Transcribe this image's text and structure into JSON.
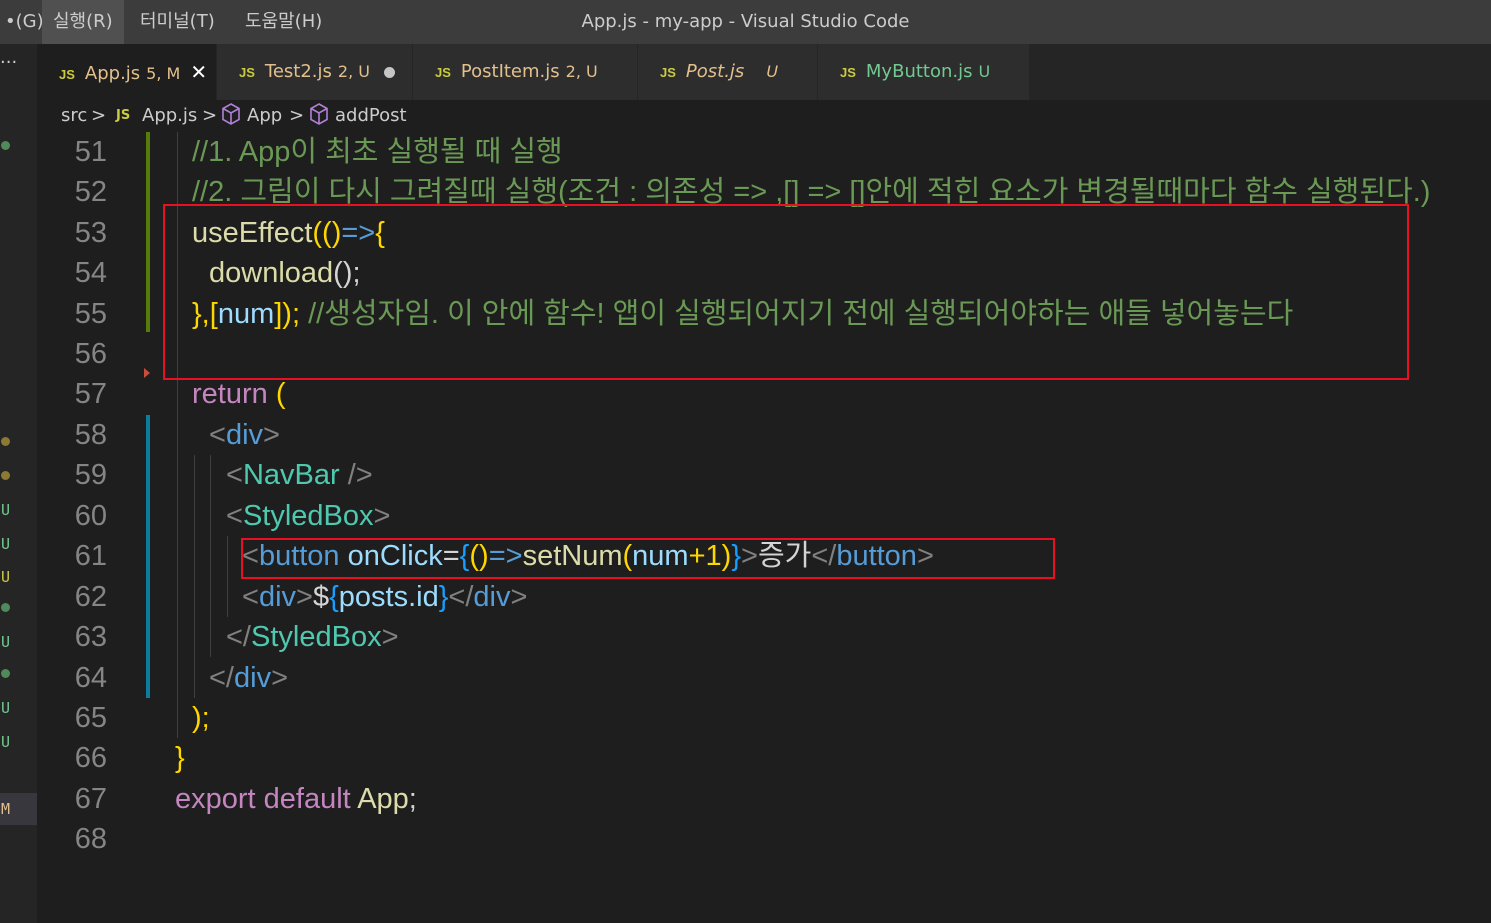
{
  "menu": {
    "items": [
      "•(G)",
      "실행(R)",
      "터미널(T)",
      "도움말(H)"
    ]
  },
  "window_title": "App.js - my-app - Visual Studio Code",
  "explorer": {
    "more_label": "···"
  },
  "git_markers": [
    {
      "kind": "dot",
      "color": "#4f8a5b"
    },
    {
      "kind": "dot",
      "color": "#8a7a33"
    },
    {
      "kind": "dot",
      "color": "#8a7a33"
    },
    {
      "kind": "letter",
      "text": "U",
      "color": "#73c991"
    },
    {
      "kind": "letter",
      "text": "U",
      "color": "#73c991"
    },
    {
      "kind": "letter",
      "text": "U",
      "color": "#cbcb41"
    },
    {
      "kind": "dot",
      "color": "#4f8a5b"
    },
    {
      "kind": "letter",
      "text": "U",
      "color": "#73c991"
    },
    {
      "kind": "dot",
      "color": "#4f8a5b"
    },
    {
      "kind": "letter",
      "text": "U",
      "color": "#73c991"
    },
    {
      "kind": "letter",
      "text": "U",
      "color": "#73c991"
    },
    {
      "kind": "letter",
      "text": "M",
      "color": "#e2c08d"
    }
  ],
  "tabs": [
    {
      "icon": "JS",
      "name": "App.js",
      "status": "5, M",
      "state": "modified",
      "active": true,
      "close": "✕"
    },
    {
      "icon": "JS",
      "name": "Test2.js",
      "status": "2, U",
      "state": "modified",
      "active": false,
      "dirty": true
    },
    {
      "icon": "JS",
      "name": "PostItem.js",
      "status": "2, U",
      "state": "modified",
      "active": false
    },
    {
      "icon": "JS",
      "name": "Post.js",
      "status": "U",
      "state": "italic",
      "active": false
    },
    {
      "icon": "JS",
      "name": "MyButton.js",
      "status": "U",
      "state": "untracked",
      "active": false
    }
  ],
  "breadcrumb": {
    "folder": "src",
    "file_icon": "JS",
    "file": "App.js",
    "symbol1": "App",
    "symbol2": "addPost",
    "separator": ">"
  },
  "code": {
    "line_numbers": [
      "51",
      "52",
      "53",
      "54",
      "55",
      "56",
      "57",
      "58",
      "59",
      "60",
      "61",
      "62",
      "63",
      "64",
      "65",
      "66",
      "67",
      "68"
    ],
    "l51": "//1. App이 최초 실행될 때 실행",
    "l52": "//2. 그림이 다시 그려질때 실행(조건 : 의존성 => ,[] => []안에 적힌 요소가 변경될때마다 함수 실행된다.)",
    "l53_fn": "useEffect",
    "l53_p1": "(()",
    "l53_arrow": "=>",
    "l53_brace": "{",
    "l54_fn": "download",
    "l54_p": "();",
    "l55_p1": "},[",
    "l55_var": "num",
    "l55_p2": "]);",
    "l55_comment": " //생성자임. 이 안에 함수! 앱이 실행되어지기 전에 실행되어야하는 애들 넣어놓는다",
    "l57_kw": "return",
    "l57_p": " (",
    "l58_lt": "<",
    "l58_tag": "div",
    "l58_gt": ">",
    "l59_lt": "<",
    "l59_comp": "NavBar",
    "l59_end": " />",
    "l60_lt": "<",
    "l60_comp": "StyledBox",
    "l60_gt": ">",
    "l61_lt": "<",
    "l61_tag": "button",
    "l61_attr": " onClick",
    "l61_eq": "=",
    "l61_ob": "{",
    "l61_paren": "()",
    "l61_arrow": "=>",
    "l61_fn": "setNum",
    "l61_op": "(",
    "l61_var": "num",
    "l61_plus": "+1)",
    "l61_cb": "}",
    "l61_gt": ">",
    "l61_text": "증가",
    "l61_close_lt": "</",
    "l61_close_tag": "button",
    "l61_close_gt": ">",
    "l62_lt": "<",
    "l62_tag": "div",
    "l62_gt": ">",
    "l62_dollar": "$",
    "l62_ob": "{",
    "l62_var": "posts.id",
    "l62_cb": "}",
    "l62_close_lt": "</",
    "l62_close_tag": "div",
    "l62_close_gt": ">",
    "l63_lt": "</",
    "l63_comp": "StyledBox",
    "l63_gt": ">",
    "l64_lt": "</",
    "l64_tag": "div",
    "l64_gt": ">",
    "l65": ");",
    "l66": "}",
    "l67_kw": "export default",
    "l67_fn": " App",
    "l67_semi": ";"
  },
  "colors": {
    "red_box": "#e81123",
    "gutter_added": "#587c0c",
    "gutter_modified": "#0c7d9d"
  }
}
